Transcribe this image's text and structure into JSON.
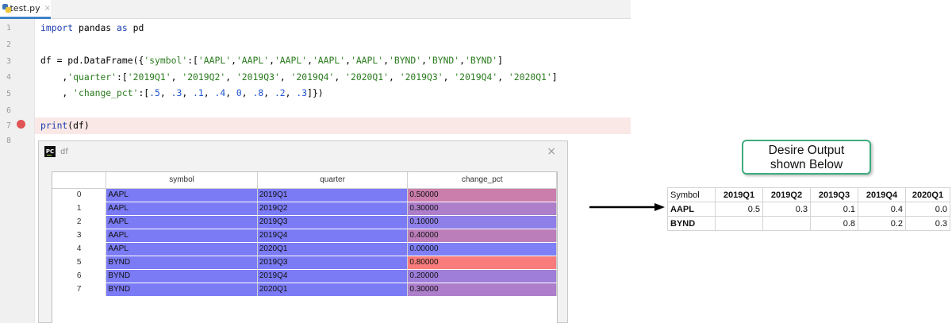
{
  "tab": {
    "filename": "test.py",
    "close_glyph": "×",
    "icon": "python-file-icon"
  },
  "gutter": {
    "line_numbers": [
      "1",
      "2",
      "3",
      "4",
      "5",
      "6",
      "7",
      "8"
    ],
    "breakpoint_color": "#e05555"
  },
  "code": {
    "line1": {
      "kw": "import",
      "rest1": " pandas ",
      "kw2": "as",
      "rest2": " pd"
    },
    "line3": {
      "prefix": "df = pd.DataFrame({",
      "key": "'symbol'",
      "colon_open": ":[",
      "items": [
        "'AAPL'",
        "'AAPL'",
        "'AAPL'",
        "'AAPL'",
        "'AAPL'",
        "'BYND'",
        "'BYND'",
        "'BYND'"
      ],
      "close": "]"
    },
    "line4": {
      "prefix": "    ,",
      "key": "'quarter'",
      "colon_open": ":[",
      "items": [
        "'2019Q1'",
        "'2019Q2'",
        "'2019Q3'",
        "'2019Q4'",
        "'2020Q1'",
        "'2019Q3'",
        "'2019Q4'",
        "'2020Q1'"
      ],
      "close": "]"
    },
    "line5": {
      "prefix": "    , ",
      "key": "'change_pct'",
      "colon_open": ":[",
      "items": [
        ".5",
        ".3",
        ".1",
        ".4",
        "0",
        ".8",
        ".2",
        ".3"
      ],
      "close": "]})"
    },
    "line7": {
      "fn": "print",
      "rest": "(df)"
    }
  },
  "viewer": {
    "title": "df",
    "logo_text": "PC",
    "close_glyph": "×",
    "columns": [
      "symbol",
      "quarter",
      "change_pct"
    ],
    "rows": [
      {
        "idx": "0",
        "symbol": "AAPL",
        "quarter": "2019Q1",
        "change_pct": "0.50000",
        "value": 0.5
      },
      {
        "idx": "1",
        "symbol": "AAPL",
        "quarter": "2019Q2",
        "change_pct": "0.30000",
        "value": 0.3
      },
      {
        "idx": "2",
        "symbol": "AAPL",
        "quarter": "2019Q3",
        "change_pct": "0.10000",
        "value": 0.1
      },
      {
        "idx": "3",
        "symbol": "AAPL",
        "quarter": "2019Q4",
        "change_pct": "0.40000",
        "value": 0.4
      },
      {
        "idx": "4",
        "symbol": "AAPL",
        "quarter": "2020Q1",
        "change_pct": "0.00000",
        "value": 0.0
      },
      {
        "idx": "5",
        "symbol": "BYND",
        "quarter": "2019Q3",
        "change_pct": "0.80000",
        "value": 0.8
      },
      {
        "idx": "6",
        "symbol": "BYND",
        "quarter": "2019Q4",
        "change_pct": "0.20000",
        "value": 0.2
      },
      {
        "idx": "7",
        "symbol": "BYND",
        "quarter": "2020Q1",
        "change_pct": "0.30000",
        "value": 0.3
      }
    ],
    "colors": {
      "text_cell": "#7b7bf6",
      "low": "#7f7ff8",
      "high": "#f97c7c"
    }
  },
  "callout": {
    "line1": "Desire Output",
    "line2": "shown Below",
    "border_color": "#3fad7e"
  },
  "desired": {
    "corner": "Symbol",
    "columns": [
      "2019Q1",
      "2019Q2",
      "2019Q3",
      "2019Q4",
      "2020Q1"
    ],
    "rows": [
      {
        "symbol": "AAPL",
        "values": [
          "0.5",
          "0.3",
          "0.1",
          "0.4",
          "0.0"
        ]
      },
      {
        "symbol": "BYND",
        "values": [
          "",
          "",
          "0.8",
          "0.2",
          "0.3"
        ]
      }
    ]
  }
}
